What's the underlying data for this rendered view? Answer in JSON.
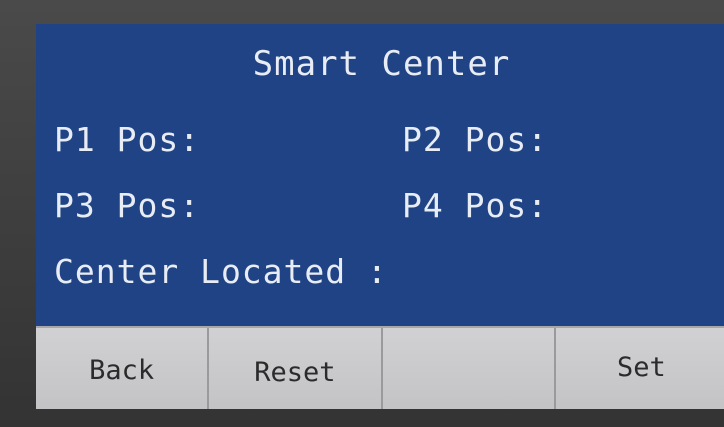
{
  "screen": {
    "title": "Smart Center"
  },
  "fields": {
    "p1_label": "P1 Pos:",
    "p2_label": "P2 Pos:",
    "p3_label": "P3 Pos:",
    "p4_label": "P4 Pos:",
    "center_label": "Center Located :"
  },
  "softkeys": {
    "back": "Back",
    "reset": "Reset",
    "empty": "",
    "set": "Set"
  },
  "colors": {
    "screen_background": "#1f4384",
    "screen_text": "#e8ecf4",
    "softkey_background": "#c9c9cb",
    "softkey_text": "#2b2b2b"
  }
}
